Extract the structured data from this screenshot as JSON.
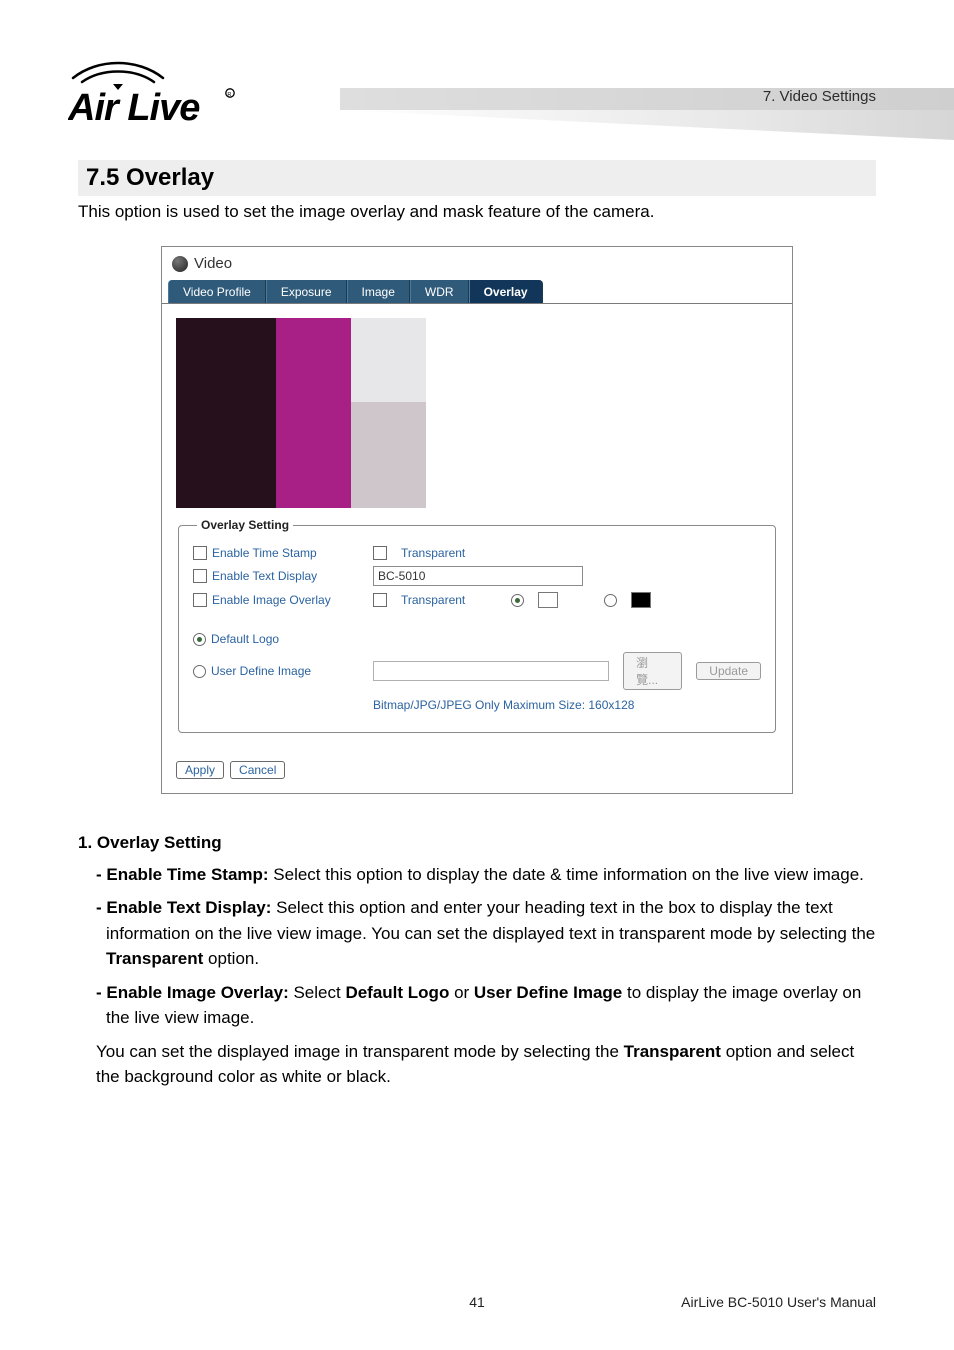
{
  "header": {
    "chapter_label": "7. Video Settings",
    "logo_alt": "Air Live"
  },
  "section": {
    "number_title": "7.5 Overlay",
    "intro": "This option is used to set the image overlay and mask feature of the camera."
  },
  "screenshot": {
    "window_title": "Video",
    "tabs": {
      "video_profile": "Video Profile",
      "exposure": "Exposure",
      "image": "Image",
      "wdr": "WDR",
      "overlay": "Overlay"
    },
    "fieldset_legend": "Overlay Setting",
    "rows": {
      "enable_time_stamp": "Enable Time Stamp",
      "transparent1": "Transparent",
      "enable_text_display": "Enable Text Display",
      "text_value": "BC-5010",
      "enable_image_overlay": "Enable Image Overlay",
      "transparent2": "Transparent",
      "default_logo": "Default Logo",
      "user_define_image": "User Define Image",
      "browse_btn": "瀏覽...",
      "update_btn": "Update",
      "hint": "Bitmap/JPG/JPEG Only Maximum Size: 160x128"
    },
    "buttons": {
      "apply": "Apply",
      "cancel": "Cancel"
    }
  },
  "body": {
    "h_overlay_setting": "1. Overlay Setting",
    "enable_time_stamp_label": "- Enable Time Stamp:",
    "enable_time_stamp_text": " Select this option to display the date & time information on the live view image.",
    "enable_text_display_label": "- Enable Text Display:",
    "enable_text_display_text_1": " Select this option and enter your heading text in the box to display the text information on the live view image. You can set the displayed text in transparent mode by selecting the ",
    "transparent_bold": "Transparent",
    "enable_text_display_text_2": " option.",
    "enable_image_overlay_label": "- Enable Image Overlay:",
    "enable_image_overlay_text_1": " Select ",
    "default_logo_bold": "Default Logo",
    "enable_image_overlay_text_2": " or ",
    "user_define_image_bold": "User Define Image",
    "enable_image_overlay_text_3": " to display the image overlay on the live view image.",
    "transparent_para_1": "You can set the displayed image in transparent mode by selecting the ",
    "transparent_para_bold": "Transparent",
    "transparent_para_2": " option and select the background color as white or black."
  },
  "footer": {
    "page_number": "41",
    "title": "AirLive BC-5010 User's Manual"
  }
}
